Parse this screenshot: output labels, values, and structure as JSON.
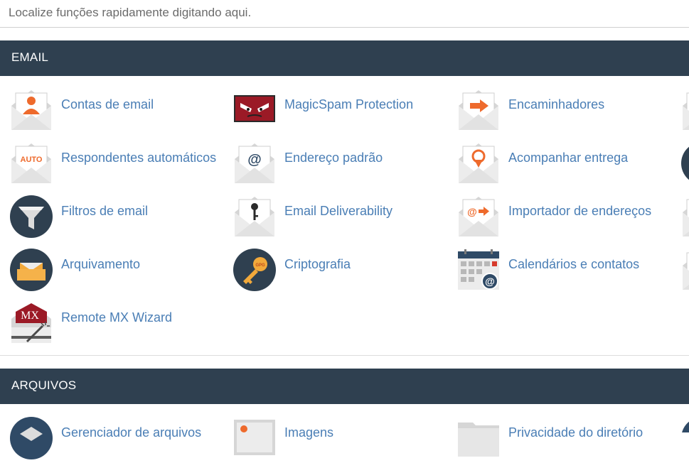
{
  "search": {
    "placeholder": "Localize funções rapidamente digitando aqui."
  },
  "sections": [
    {
      "title": "EMAIL",
      "items": [
        {
          "label": "Contas de email",
          "icon": "email-accounts-icon"
        },
        {
          "label": "MagicSpam Protection",
          "icon": "magicspam-icon"
        },
        {
          "label": "Encaminhadores",
          "icon": "forwarders-icon"
        },
        {
          "label": "Respondentes automáticos",
          "icon": "autoresponders-icon"
        },
        {
          "label": "Endereço padrão",
          "icon": "default-address-icon"
        },
        {
          "label": "Acompanhar entrega",
          "icon": "track-delivery-icon"
        },
        {
          "label": "Filtros de email",
          "icon": "email-filters-icon"
        },
        {
          "label": "Email Deliverability",
          "icon": "email-deliverability-icon"
        },
        {
          "label": "Importador de endereços",
          "icon": "address-importer-icon"
        },
        {
          "label": "Arquivamento",
          "icon": "archive-icon"
        },
        {
          "label": "Criptografia",
          "icon": "encryption-icon"
        },
        {
          "label": "Calendários e contatos",
          "icon": "calendar-icon"
        },
        {
          "label": "Remote MX Wizard",
          "icon": "remote-mx-icon"
        }
      ]
    },
    {
      "title": "ARQUIVOS",
      "items": [
        {
          "label": "Gerenciador de arquivos",
          "icon": "file-manager-icon"
        },
        {
          "label": "Imagens",
          "icon": "images-icon"
        },
        {
          "label": "Privacidade do diretório",
          "icon": "directory-privacy-icon"
        }
      ]
    }
  ]
}
